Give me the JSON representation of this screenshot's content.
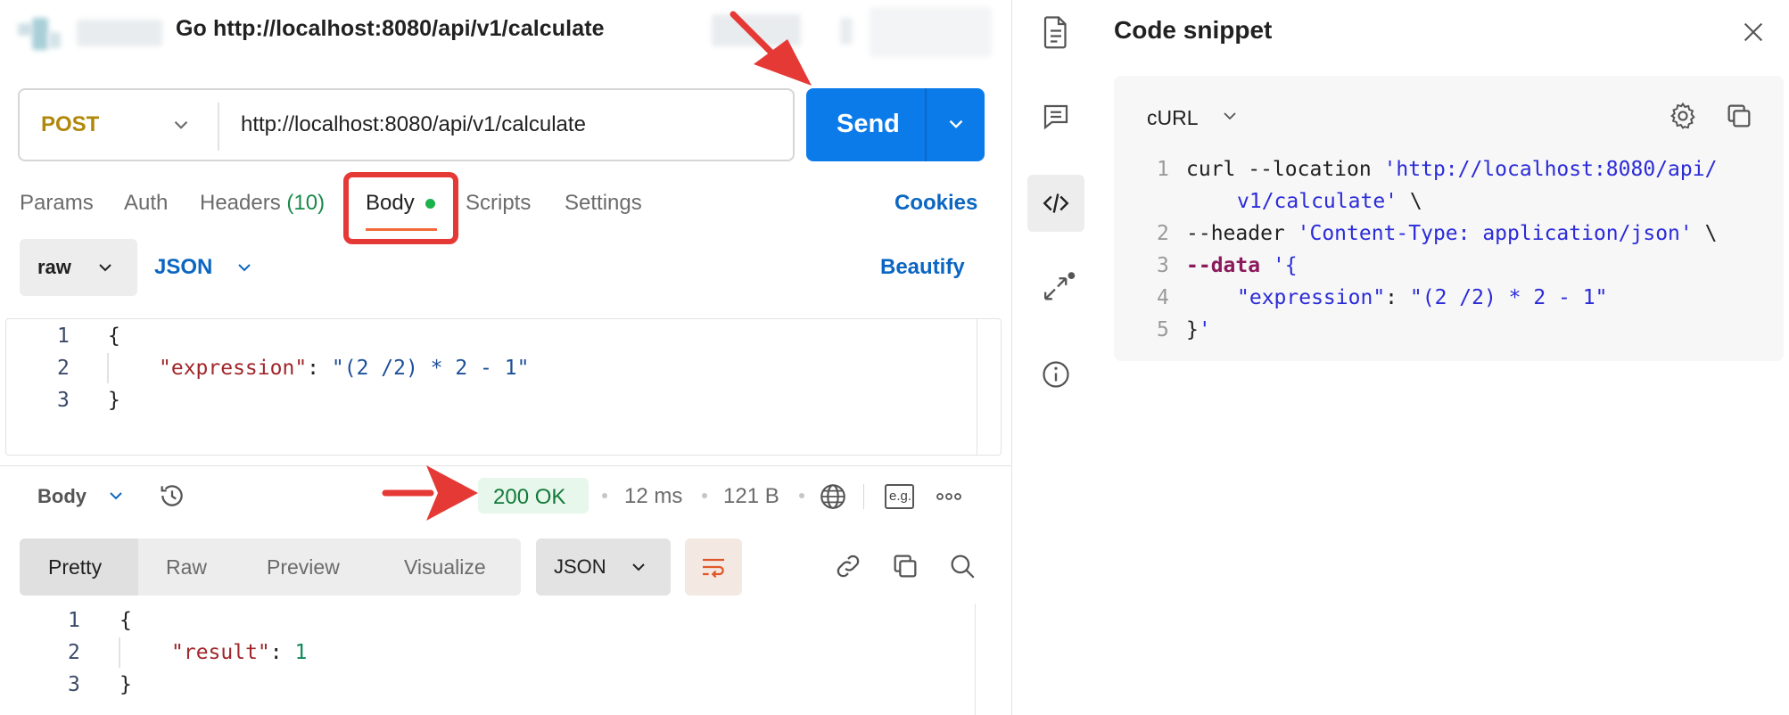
{
  "request": {
    "title": "Go http://localhost:8080/api/v1/calculate",
    "method": "POST",
    "url": "http://localhost:8080/api/v1/calculate",
    "send_label": "Send"
  },
  "request_tabs": {
    "params": "Params",
    "auth": "Auth",
    "headers": "Headers",
    "headers_count": "(10)",
    "body": "Body",
    "scripts": "Scripts",
    "settings": "Settings",
    "active": "Body"
  },
  "cookies_label": "Cookies",
  "body_options": {
    "mode": "raw",
    "language": "JSON",
    "beautify_label": "Beautify"
  },
  "request_body": {
    "line_numbers": [
      "1",
      "2",
      "3"
    ],
    "open_brace": "{",
    "key": "\"expression\"",
    "colon": ": ",
    "value": "\"(2 /2) * 2 - 1\"",
    "close_brace": "}"
  },
  "response_bar": {
    "body_label": "Body",
    "status": "200 OK",
    "time": "12 ms",
    "size": "121 B",
    "eg_label": "e.g."
  },
  "response_view": {
    "tabs": [
      "Pretty",
      "Raw",
      "Preview",
      "Visualize"
    ],
    "active_tab": "Pretty",
    "format": "JSON"
  },
  "response_body": {
    "line_numbers": [
      "1",
      "2",
      "3"
    ],
    "open_brace": "{",
    "key": "\"result\"",
    "colon": ": ",
    "value": "1",
    "close_brace": "}"
  },
  "code_snippet": {
    "title": "Code snippet",
    "language": "cURL",
    "line_numbers": [
      "1",
      "2",
      "3",
      "4",
      "5"
    ],
    "line1_cmd": "curl --location ",
    "line1_url_a": "'http://localhost:8080/api/",
    "line1_url_b": "v1/calculate'",
    "line1_cont": " \\",
    "line2_flag": "--header ",
    "line2_value": "'Content-Type: application/json'",
    "line2_cont": " \\",
    "line3_flag": "--data",
    "line3_value": " '{",
    "line4_key": "\"expression\"",
    "line4_colon": ": ",
    "line4_value": "\"(2 /2) * 2 - 1\"",
    "line5_brace": "}",
    "line5_quote": "'"
  },
  "colors": {
    "send": "#0c7bea",
    "method": "#b1880b",
    "link": "#0b66c2",
    "status_ok": "#137a3a",
    "annotation": "#e53935",
    "active_tab_underline": "#f26b3a"
  },
  "icons": [
    "document-icon",
    "comment-icon",
    "code-icon",
    "related-icon",
    "info-icon",
    "history-icon",
    "globe-icon",
    "more-icon",
    "link-icon",
    "copy-icon",
    "search-icon",
    "settings-icon",
    "close-icon",
    "wrap-icon"
  ]
}
